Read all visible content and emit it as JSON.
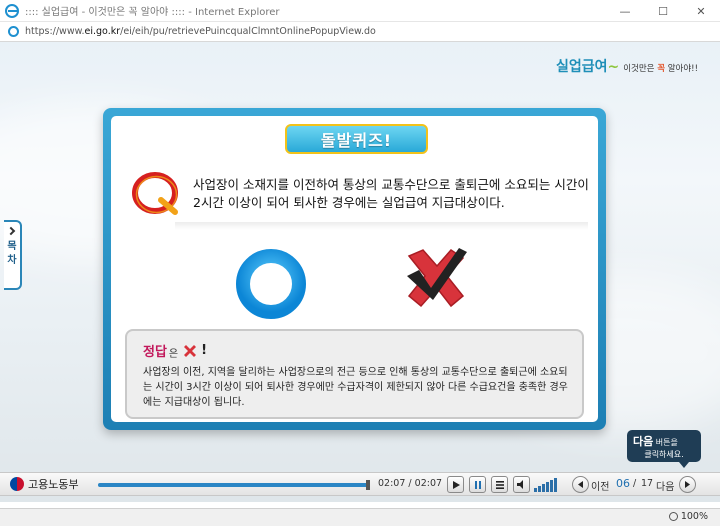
{
  "window": {
    "title": ":::: 실업급여 - 이것만은 꼭 알아야 :::: - Internet Explorer",
    "minimize": "—",
    "maximize": "☐",
    "close": "✕"
  },
  "address": {
    "url_prefix": "https://www.",
    "url_domain": "ei.go.kr",
    "url_path": "/ei/eih/pu/retrievePuincqualClmntOnlinePopupView.do"
  },
  "brand": {
    "main": "실업급여",
    "tilde": "~",
    "sub_prefix": "이것만은 ",
    "sub_highlight": "꼭",
    "sub_suffix": " 알아야!!"
  },
  "toc": {
    "label": "목차"
  },
  "quiz": {
    "banner": "돌발퀴즈!",
    "question": "사업장이 소재지를 이전하여 통상의 교통수단으로 출퇴근에 소요되는 시간이 2시간 이상이 되어 퇴사한 경우에는 실업급여 지급대상이다.",
    "answer_label": "정답",
    "answer_eun": "은",
    "answer_excl": "!",
    "explanation": "사업장의 이전, 지역을 달리하는 사업장으로의 전근 등으로 인해 통상의 교통수단으로 출퇴근에 소요되는 시간이 3시간 이상이 되어 퇴사한 경우에만 수급자격이 제한되지 않아 다른 수급요건을 충족한 경우에는 지급대상이 됩니다."
  },
  "next_tip": {
    "bold": "다음",
    "small": "버튼을",
    "line2": "클릭하세요."
  },
  "player": {
    "org_name": "고용노동부",
    "progress": 1.0,
    "time_current": "02:07",
    "time_sep": "/",
    "time_total": "02:07",
    "prev_label": "이전",
    "page_current": "06",
    "page_sep": "/",
    "page_total": "17",
    "next_label": "다음"
  },
  "status": {
    "zoom": "100%"
  },
  "colors": {
    "accent": "#1d7fb4",
    "banner_border": "#f2c21a",
    "answer_label": "#c2185b"
  }
}
